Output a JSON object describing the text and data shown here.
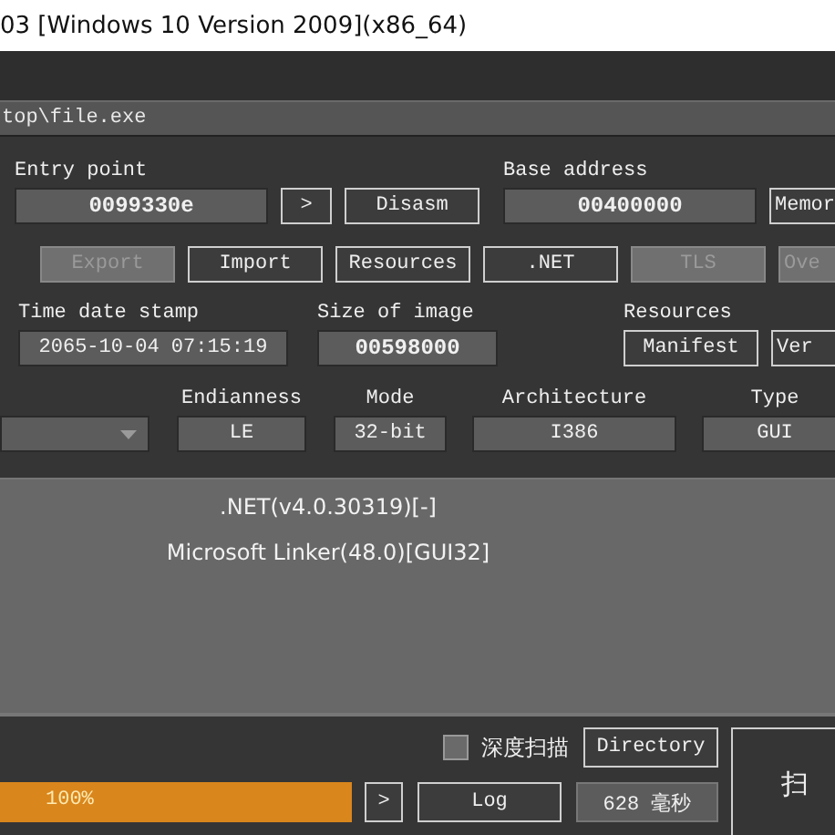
{
  "window": {
    "title": "03 [Windows 10 Version 2009](x86_64)"
  },
  "file_path": "top\\file.exe",
  "entry_point": {
    "label": "Entry point",
    "value": "0099330e",
    "go_button": ">",
    "disasm_button": "Disasm"
  },
  "base_address": {
    "label": "Base address",
    "value": "00400000",
    "memory_button": "Memor"
  },
  "section_buttons": [
    {
      "label": "Export",
      "disabled": true
    },
    {
      "label": "Import",
      "disabled": false
    },
    {
      "label": "Resources",
      "disabled": false
    },
    {
      "label": ".NET",
      "disabled": false
    },
    {
      "label": "TLS",
      "disabled": true
    },
    {
      "label": "Ove",
      "disabled": true
    }
  ],
  "time_date_stamp": {
    "label": "Time date stamp",
    "value": "2065-10-04 07:15:19"
  },
  "size_of_image": {
    "label": "Size of image",
    "value": "00598000"
  },
  "resources": {
    "label": "Resources",
    "buttons": [
      "Manifest",
      "Ver"
    ]
  },
  "attributes": [
    {
      "label": "Endianness",
      "value": "LE"
    },
    {
      "label": "Mode",
      "value": "32-bit"
    },
    {
      "label": "Architecture",
      "value": "I386"
    },
    {
      "label": "Type",
      "value": "GUI"
    }
  ],
  "detections": [
    ".NET(v4.0.30319)[-]",
    "Microsoft Linker(48.0)[GUI32]"
  ],
  "deep_scan": {
    "label": "深度扫描",
    "checked": false
  },
  "directory_button": "Directory",
  "progress": {
    "level": 1,
    "text": "100%"
  },
  "log_go_button": ">",
  "log_button": "Log",
  "elapsed": "628 毫秒",
  "scan_button": "扫"
}
